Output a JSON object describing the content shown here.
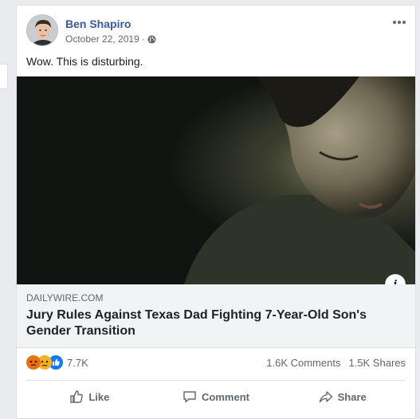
{
  "post": {
    "author": "Ben Shapiro",
    "date": "October 22, 2019",
    "separator": "·",
    "caption": "Wow. This is disturbing."
  },
  "link": {
    "domain": "DAILYWIRE.COM",
    "title": "Jury Rules Against Texas Dad Fighting 7-Year-Old Son's Gender Transition",
    "info_label": "i"
  },
  "stats": {
    "reactions_count": "7.7K",
    "comments": "1.6K Comments",
    "shares": "1.5K Shares",
    "reaction_icons": [
      "angry-reaction-icon",
      "sad-reaction-icon",
      "like-reaction-icon"
    ]
  },
  "actions": {
    "like": "Like",
    "comment": "Comment",
    "share": "Share"
  },
  "colors": {
    "link_blue": "#385898",
    "secondary_text": "#606770",
    "like_blue": "#1877f2",
    "angry_orange": "#e9710f",
    "sad_yellow": "#f7b125"
  }
}
